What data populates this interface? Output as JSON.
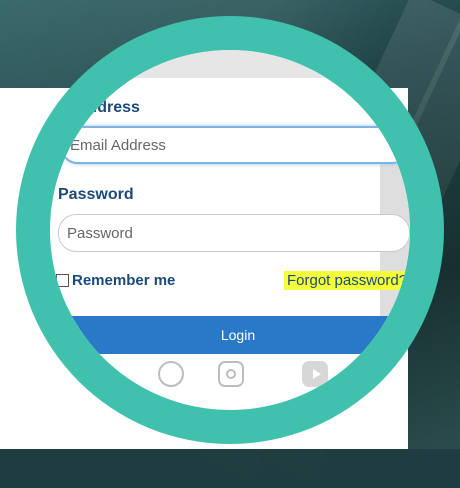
{
  "login_form": {
    "email_label": "mail Address",
    "email_placeholder": "Email Address",
    "password_label": "Password",
    "password_placeholder": "Password",
    "remember_label": "Remember me",
    "remember_checked": false,
    "forgot_link": "Forgot password?",
    "login_button": "Login"
  },
  "social_icons": [
    "circle-social-icon",
    "instagram-icon",
    "youtube-icon"
  ],
  "colors": {
    "lens_ring": "#3fc1ad",
    "label_blue": "#1b4a7a",
    "login_button": "#2a78c8",
    "highlight": "#f5ff3a"
  }
}
